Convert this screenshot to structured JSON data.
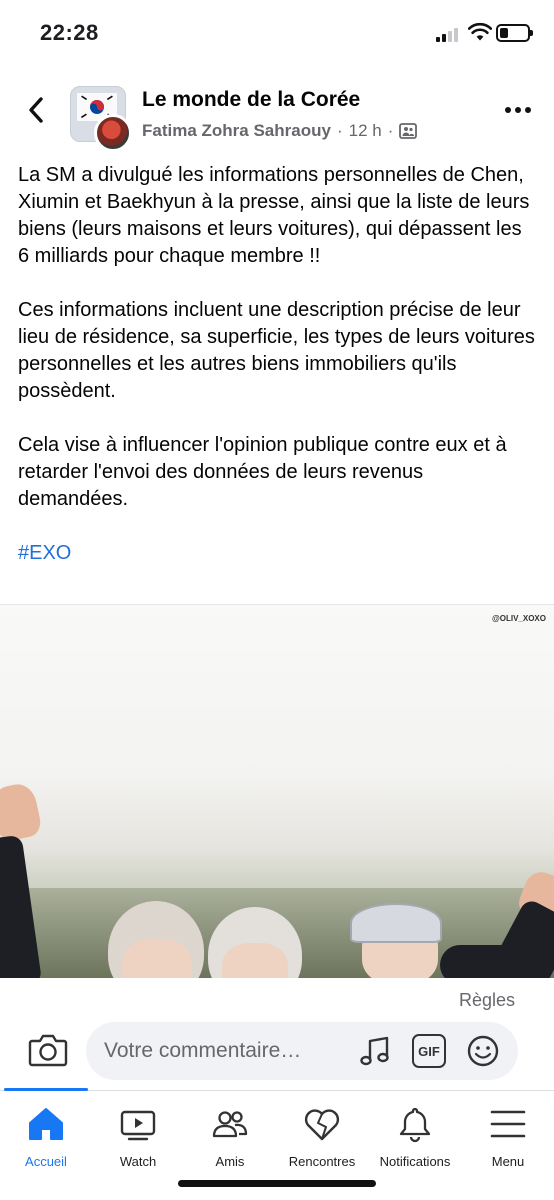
{
  "status_bar": {
    "time": "22:28",
    "icons": [
      "cellular-signal-icon",
      "wifi-icon",
      "battery-icon"
    ],
    "battery_level": 0.3
  },
  "post": {
    "group_name": "Le monde de la Corée",
    "author": "Fatima Zohra Sahraouy",
    "time_ago": "12 h",
    "separator": "·",
    "audience_icon": "group-audience-icon",
    "paragraphs": [
      "La SM a divulgué les informations personnelles de Chen, Xiumin et Baekhyun à la presse, ainsi que la liste de leurs biens (leurs maisons et leurs voitures), qui dépassent les 6 milliards pour chaque membre !!",
      "Ces informations incluent une description précise de leur lieu de résidence, sa superficie, les types de leurs voitures personnelles et les autres biens immobiliers qu'ils possèdent.",
      "Cela vise à influencer l'opinion publique contre eux et à retarder l'envoi des données de leurs revenus demandées."
    ],
    "hashtag": "#EXO",
    "image_watermark": "@OLIV_XOXO"
  },
  "comment_bar": {
    "rules_label": "Règles",
    "placeholder": "Votre commentaire…",
    "icons": [
      "camera-icon",
      "music-icon",
      "gif-icon",
      "emoji-icon"
    ],
    "gif_label": "GIF"
  },
  "bottom_nav": {
    "active_index": 0,
    "accent_color": "#1877f2",
    "items": [
      {
        "label": "Accueil",
        "icon": "home-icon"
      },
      {
        "label": "Watch",
        "icon": "watch-icon"
      },
      {
        "label": "Amis",
        "icon": "friends-icon"
      },
      {
        "label": "Rencontres",
        "icon": "dating-icon"
      },
      {
        "label": "Notifications",
        "icon": "bell-icon"
      },
      {
        "label": "Menu",
        "icon": "menu-icon"
      }
    ]
  }
}
